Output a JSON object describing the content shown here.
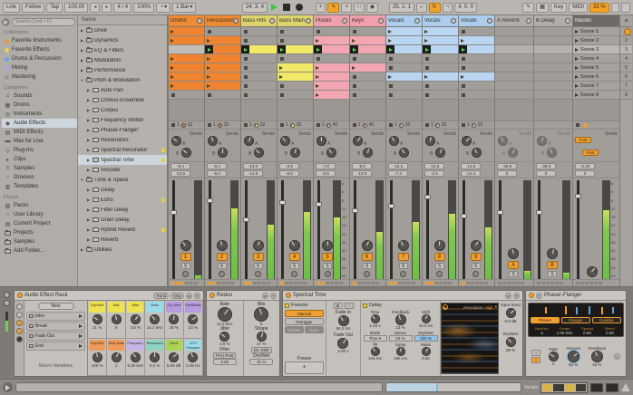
{
  "icons": {
    "metronome": "◔",
    "dropdown": "▾",
    "nudge_down": "◂",
    "nudge_up": "▸",
    "plus": "+",
    "automation": "✎",
    "capture": "∷",
    "session_record": "◉",
    "draw": "✎",
    "kbd": "▦",
    "list": "≡",
    "punch_in": "⌐",
    "punch_out": "¬",
    "loop": "↻",
    "freeze": "*",
    "wave_a": "~",
    "wave_b": "≈",
    "fav_dot": "●"
  },
  "toolbar": {
    "link": "Link",
    "follow": "Follow",
    "tap": "Tap",
    "tempo": "100.00",
    "time_sig": "4 / 4",
    "groove_amount": "100%",
    "quantize": "1 Bar",
    "position": "24. 3. 4",
    "loop_start": "25. 1. 1",
    "loop_length": "4. 0. 0",
    "key": "Key",
    "midi": "MIDI",
    "cpu": "33 %"
  },
  "sidebar": {
    "search_placeholder": "Search (Cmd + F)",
    "sections": [
      {
        "title": "Collections",
        "items": [
          {
            "label": "Favorite Instruments",
            "dot": "#f0953f"
          },
          {
            "label": "Favorite Effects",
            "dot": "#e8d24a"
          },
          {
            "label": "Drums & Percussion",
            "dot": "#6aa2e8"
          },
          {
            "label": "Mixing",
            "dot": "#b9a0e8"
          },
          {
            "label": "Mastering",
            "dot": "#9a9792"
          }
        ]
      },
      {
        "title": "Categories",
        "items": [
          {
            "label": "Sounds",
            "icon": "♫"
          },
          {
            "label": "Drums",
            "icon": "▦"
          },
          {
            "label": "Instruments",
            "icon": "◎"
          },
          {
            "label": "Audio Effects",
            "icon": "◉",
            "selected": true
          },
          {
            "label": "MIDI Effects",
            "icon": "▤"
          },
          {
            "label": "Max for Live",
            "icon": "▬"
          },
          {
            "label": "Plug-Ins",
            "icon": "◇"
          },
          {
            "label": "Clips",
            "icon": "▸"
          },
          {
            "label": "Samples",
            "icon": "≡"
          },
          {
            "label": "Grooves",
            "icon": "~"
          },
          {
            "label": "Templates",
            "icon": "▥"
          }
        ]
      },
      {
        "title": "Places",
        "items": [
          {
            "label": "Packs",
            "icon": "▨"
          },
          {
            "label": "User Library",
            "icon": "○"
          },
          {
            "label": "Current Project",
            "icon": "▤"
          },
          {
            "label": "Projects",
            "icon": "folder"
          },
          {
            "label": "Samples",
            "icon": "folder"
          },
          {
            "label": "Add Folder...",
            "icon": "folder"
          }
        ]
      }
    ]
  },
  "browser": {
    "list_header": "Name",
    "items": [
      {
        "label": "Drive",
        "depth": 0,
        "arrow": "▶",
        "type": "folder"
      },
      {
        "label": "Dynamics",
        "depth": 0,
        "arrow": "▶",
        "type": "folder"
      },
      {
        "label": "EQ & Filters",
        "depth": 0,
        "arrow": "▶",
        "type": "folder"
      },
      {
        "label": "Modulators",
        "depth": 0,
        "arrow": "▶",
        "type": "folder"
      },
      {
        "label": "Performance",
        "depth": 0,
        "arrow": "▶",
        "type": "folder"
      },
      {
        "label": "Pitch & Modulation",
        "depth": 0,
        "arrow": "▼",
        "type": "folder"
      },
      {
        "label": "Auto Pan",
        "depth": 1,
        "arrow": "▶",
        "type": "device"
      },
      {
        "label": "Chorus-Ensemble",
        "depth": 1,
        "arrow": "▶",
        "type": "device"
      },
      {
        "label": "Corpus",
        "depth": 1,
        "arrow": "▶",
        "type": "device"
      },
      {
        "label": "Frequency Shifter",
        "depth": 1,
        "arrow": "▶",
        "type": "device"
      },
      {
        "label": "Phaser-Flanger",
        "depth": 1,
        "arrow": "▶",
        "type": "device"
      },
      {
        "label": "Resonators",
        "depth": 1,
        "arrow": "▶",
        "type": "device"
      },
      {
        "label": "Spectral Resonator",
        "depth": 1,
        "arrow": "▶",
        "type": "device",
        "fav": true
      },
      {
        "label": "Spectral Time",
        "depth": 1,
        "arrow": "▶",
        "type": "device",
        "fav": true,
        "selected": true
      },
      {
        "label": "Vocoder",
        "depth": 1,
        "arrow": "▶",
        "type": "device"
      },
      {
        "label": "Time & Space",
        "depth": 0,
        "arrow": "▼",
        "type": "folder"
      },
      {
        "label": "Delay",
        "depth": 1,
        "arrow": "▶",
        "type": "device"
      },
      {
        "label": "Echo",
        "depth": 1,
        "arrow": "▶",
        "type": "device",
        "fav": true
      },
      {
        "label": "Filter Delay",
        "depth": 1,
        "arrow": "▶",
        "type": "device"
      },
      {
        "label": "Grain Delay",
        "depth": 1,
        "arrow": "▶",
        "type": "device"
      },
      {
        "label": "Hybrid Reverb",
        "depth": 1,
        "arrow": "▶",
        "type": "device",
        "fav": true
      },
      {
        "label": "Reverb",
        "depth": 1,
        "arrow": "▶",
        "type": "device"
      },
      {
        "label": "Utilities",
        "depth": 0,
        "arrow": "▶",
        "type": "folder"
      }
    ]
  },
  "session": {
    "sends_label": "Sends",
    "post_label": "Post",
    "solo_label": "S",
    "meter_scale": [
      "6",
      "0",
      "6",
      "12",
      "18",
      "24",
      "30",
      "36",
      "42",
      "48",
      "54",
      "60"
    ],
    "selected_scene_index": 2,
    "scenes": [
      "Scene 1",
      "Scene 2",
      "Scene 3",
      "Scene 4",
      "Scene 5",
      "Scene 6",
      "Scene 7",
      "Scene 8"
    ],
    "scene_numbers": [
      "1",
      "2",
      "3",
      "4",
      "5",
      "6",
      "7",
      "8"
    ],
    "tracks": [
      {
        "name": "Drums",
        "header": "#ee8a33",
        "clip": "#ef8430",
        "slots": [
          "clip",
          "clip",
          "emptysel",
          "clip",
          "clip",
          "clip",
          "clip",
          "stop"
        ],
        "status_num": "1",
        "status_len": "32",
        "peak": "-8.4",
        "vol": "-13.5",
        "num": "1",
        "meter": 4,
        "fader": 30,
        "perf": 3
      },
      {
        "name": "Percussion",
        "header": "#ee8a33",
        "clip": "#ef8430",
        "slots": [
          "stop",
          "clip",
          "play",
          "clip",
          "clip",
          "clip",
          "clip",
          "stop"
        ],
        "status_num": "1",
        "status_len": "32",
        "peak": "-9.2",
        "vol": "-6.0",
        "num": "2",
        "meter": 72,
        "fader": 18,
        "perf": 2
      },
      {
        "name": "Bass Hits",
        "header": "#ddd46e",
        "clip": "#f0e866",
        "slots": [
          "stop",
          "stop",
          "play",
          "stop",
          "stop",
          "stop",
          "stop",
          "stop"
        ],
        "status_num": "1",
        "status_len": "32",
        "peak": "-13.0",
        "vol": "-14.9",
        "num": "3",
        "meter": 55,
        "fader": 38,
        "perf": 2
      },
      {
        "name": "Bass Main",
        "header": "#ddd46e",
        "clip": "#f0e866",
        "slots": [
          "stop",
          "stop",
          "play",
          "stop",
          "clip",
          "clip",
          "stop",
          "stop"
        ],
        "status_num": "1",
        "status_len": "32",
        "peak": "-8.8",
        "vol": "-6.0",
        "num": "4",
        "meter": 68,
        "fader": 20,
        "perf": 1
      },
      {
        "name": "Plucks",
        "header": "#f0a0ab",
        "clip": "#f3a7b3",
        "slots": [
          "stop",
          "clip",
          "play",
          "stop",
          "clip",
          "clip",
          "clip",
          "clip"
        ],
        "status_num": "1",
        "status_len": "40",
        "peak": "-7.8",
        "vol": "-5.5",
        "num": "5",
        "meter": 62,
        "fader": 22,
        "perf": 2,
        "scale": true
      },
      {
        "name": "Keys",
        "header": "#f0a0ab",
        "clip": "#f3a7b3",
        "slots": [
          "stop",
          "clip",
          "play",
          "stop",
          "clip",
          "stop",
          "stop",
          "stop"
        ],
        "status_num": "1",
        "status_len": "40",
        "peak": "-9.5",
        "vol": "-10.0",
        "num": "6",
        "meter": 48,
        "fader": 28,
        "perf": 1
      },
      {
        "name": "Vocals",
        "header": "#adcdec",
        "clip": "#b9d5f1",
        "slots": [
          "clip",
          "clip",
          "play",
          "stop",
          "stop",
          "clip",
          "stop",
          "stop"
        ],
        "status_num": "1",
        "status_len": "32",
        "peak": "-15.5",
        "vol": "-7.4",
        "num": "7",
        "meter": 58,
        "fader": 24,
        "perf": 2
      },
      {
        "name": "Vocals",
        "header": "#adcdec",
        "clip": "#b9d5f1",
        "slots": [
          "clip",
          "clip",
          "play",
          "stop",
          "stop",
          "clip",
          "stop",
          "stop"
        ],
        "status_num": "1",
        "status_len": "32",
        "peak": "-12.6",
        "vol": "-2.6",
        "num": "8",
        "meter": 66,
        "fader": 15,
        "perf": 2
      },
      {
        "name": "Vocals",
        "header": "#adcdec",
        "clip": "#b9d5f1",
        "slots": [
          "stop",
          "clip",
          "play",
          "stop",
          "stop",
          "clip",
          "stop",
          "stop"
        ],
        "status_num": "1",
        "status_len": "32",
        "peak": "-14.6",
        "vol": "-12.4",
        "num": "9",
        "meter": 52,
        "fader": 34,
        "perf": 1
      },
      {
        "name": "A Reverb",
        "type": "return",
        "header": "#b1aeaa",
        "peak": "-36.9",
        "vol": "0",
        "num": "A",
        "meter": 8,
        "fader": 30,
        "perf": 0
      },
      {
        "name": "B Delay",
        "type": "return",
        "header": "#b1aeaa",
        "peak": "-38.9",
        "vol": "0",
        "num": "B",
        "meter": 6,
        "fader": 30,
        "perf": 0
      },
      {
        "name": "Master",
        "type": "master",
        "header": "#6e6b66",
        "peak": "-5.30",
        "vol": "0",
        "meter": 70,
        "fader": 14,
        "perf": 0
      }
    ]
  },
  "devices": {
    "rack": {
      "title": "Audio Effect Rack",
      "rand": "Rand",
      "map": "Map",
      "new_label": "New",
      "variations": [
        "Intro",
        "Break",
        "Fade Out",
        "End"
      ],
      "variations_label": "Macro Variations",
      "macros": [
        {
          "label": "Dry/Wet",
          "value": "31 %",
          "color": "#efe24e"
        },
        {
          "label": "Bits",
          "value": "5",
          "color": "#efe24e"
        },
        {
          "label": "Jitter",
          "value": "3.6 %",
          "color": "#efe24e"
        },
        {
          "label": "Rate",
          "value": "14.2 kHz",
          "color": "#9adbe8"
        },
        {
          "label": "Dry Wet",
          "value": "28 %",
          "color": "#b79ae0"
        },
        {
          "label": "Feedback",
          "value": "23 %",
          "color": "#b79ae0"
        },
        {
          "label": "Dry/Wet",
          "value": "100 %",
          "color": "#f09a5a"
        },
        {
          "label": "Mod Rate",
          "value": "2",
          "color": "#f09a5a"
        },
        {
          "label": "Frequency",
          "value": "6.30 kHz",
          "color": "#c8b4e8"
        },
        {
          "label": "Resonance",
          "value": "0.0 %",
          "color": "#8fd4c0"
        },
        {
          "label": "Drive",
          "value": "8.69 dB",
          "color": "#aad455"
        },
        {
          "label": "LFO Frequen",
          "value": "0.26 Hz",
          "color": "#9adbe8"
        }
      ]
    },
    "redux": {
      "title": "Redux",
      "rate_label": "Rate",
      "rate": "14.2 kHz",
      "bits_label": "Bits",
      "bits": "6",
      "jitter_label": "Jitter",
      "jitter": "3.6 %",
      "shape_label": "Shape",
      "shape": "27 %",
      "filter_label": "Filter",
      "pre": "Pre",
      "post": "Post",
      "filter_value": "0.00",
      "dc_shift": "DC Shift",
      "drywet_label": "Dry/Wet",
      "drywet": "31 %"
    },
    "spectral": {
      "title": "Spectral Time",
      "freezer_label": "Freezer",
      "manual": "Manual",
      "retrigger": "Retrigger",
      "onsets": "Onsets",
      "sync": "Sync",
      "freeze_label": "Freeze",
      "fade_in_label": "Fade In",
      "fade_in": "55.2 ms",
      "fade_out_label": "Fade Out",
      "fade_out": "3.90 s",
      "delay_label": "Delay",
      "time_label": "Time",
      "time": "1.03 s",
      "feedback_label": "Feedback",
      "feedback": "23 %",
      "shift_label": "Shift",
      "shift": "14.0 Hz",
      "mode_label": "Mode",
      "mode": "Time",
      "stereo_label": "Stereo",
      "stereo": "53 %",
      "drywet_label": "Dry/Wet",
      "drywet": "100 %",
      "tilt_label": "Tilt",
      "tilt": "144 ms",
      "spray_label": "Spray",
      "spray": "165 ms",
      "mask_label": "Mask",
      "mask": "0.52",
      "resolution_label": "Resolution",
      "resolution": "High",
      "input_send_label": "Input Send",
      "input_send": "0.0 dB",
      "out_drywet_label": "Dry/Wet",
      "out_drywet": "28 %"
    },
    "phaser": {
      "title": "Phaser-Flanger",
      "modes": [
        "Phaser",
        "Flanger",
        "Doubler"
      ],
      "active_mode": "Phaser",
      "params": [
        {
          "label": "Notches",
          "value": "4"
        },
        {
          "label": "Center",
          "value": "1.00 kHz"
        },
        {
          "label": "Spread",
          "value": "0.50"
        },
        {
          "label": "Blend",
          "value": "0.00"
        }
      ],
      "rate_label": "Rate",
      "rate": "2",
      "amount_label": "Amount",
      "amount": "83 %",
      "feedback_label": "Feedback",
      "feedback": "16 %"
    }
  },
  "statusbar": {
    "context_label": "Vocals"
  }
}
